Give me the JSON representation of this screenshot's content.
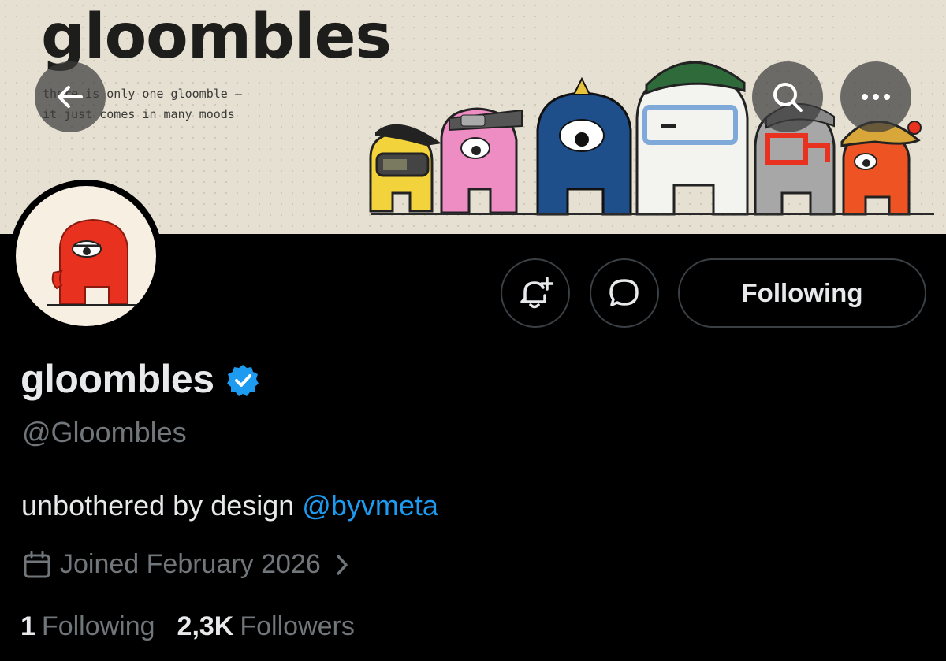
{
  "banner": {
    "title": "gloombles",
    "tagline_line1": "there is only one gloomble —",
    "tagline_line2": "it just comes in many moods"
  },
  "header_buttons": {
    "back_icon": "arrow-left-icon",
    "search_icon": "search-icon",
    "more_icon": "more-horizontal-icon"
  },
  "actions": {
    "notify_icon": "bell-plus-icon",
    "message_icon": "message-bubble-icon",
    "following_label": "Following"
  },
  "profile": {
    "display_name": "gloombles",
    "verified": true,
    "handle": "@Gloombles",
    "bio_text": "unbothered by design ",
    "bio_mention": "@byvmeta",
    "joined": "Joined February 2026",
    "following_count": "1",
    "following_label": "Following",
    "followers_count": "2,3K",
    "followers_label": "Followers"
  },
  "colors": {
    "background": "#000000",
    "accent": "#1d9bf0",
    "secondary_text": "#71767b",
    "primary_text": "#e7e9ea",
    "gloomble_red": "#e8311e",
    "gloomble_yellow": "#f2d33c",
    "gloomble_pink": "#ee8cc4",
    "gloomble_blue": "#1f4f8a",
    "gloomble_white": "#f3f3f0",
    "gloomble_gray": "#a7a7a7",
    "gloomble_orange": "#ee5323"
  }
}
